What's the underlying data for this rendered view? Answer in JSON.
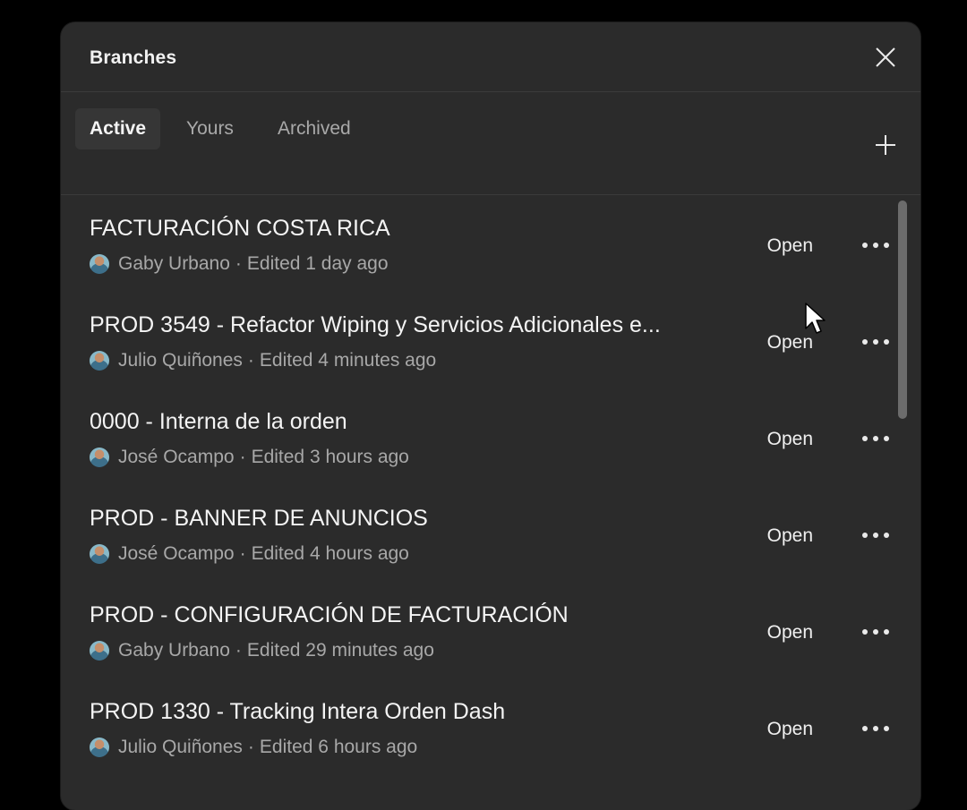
{
  "header": {
    "title": "Branches"
  },
  "tabs": [
    {
      "label": "Active"
    },
    {
      "label": "Yours"
    },
    {
      "label": "Archived"
    }
  ],
  "branches": [
    {
      "title": "FACTURACIÓN COSTA RICA",
      "author": "Gaby Urbano",
      "edited": "Edited 1 day ago",
      "action": "Open"
    },
    {
      "title": "PROD 3549 - Refactor Wiping y Servicios Adicionales e...",
      "author": "Julio Quiñones",
      "edited": "Edited 4 minutes ago",
      "action": "Open"
    },
    {
      "title": "0000 - Interna de la orden",
      "author": "José Ocampo",
      "edited": "Edited 3 hours ago",
      "action": "Open"
    },
    {
      "title": "PROD - BANNER DE ANUNCIOS",
      "author": "José Ocampo",
      "edited": "Edited 4 hours ago",
      "action": "Open"
    },
    {
      "title": "PROD - CONFIGURACIÓN DE FACTURACIÓN",
      "author": "Gaby Urbano",
      "edited": "Edited 29 minutes ago",
      "action": "Open"
    },
    {
      "title": "PROD 1330 - Tracking Intera Orden Dash",
      "author": "Julio Quiñones",
      "edited": "Edited 6 hours ago",
      "action": "Open"
    }
  ],
  "meta_separator": "·",
  "icons": {
    "close": "close-icon",
    "add": "plus-icon",
    "more": "more-horizontal-icon",
    "avatar": "avatar-icon",
    "cursor": "mouse-pointer-icon"
  },
  "colors": {
    "background": "#000000",
    "panel": "#2b2b2b",
    "active_tab": "#363636",
    "text_primary": "#f4f4f4",
    "text_secondary": "#a8a8a8",
    "divider": "#3b3b3b"
  }
}
